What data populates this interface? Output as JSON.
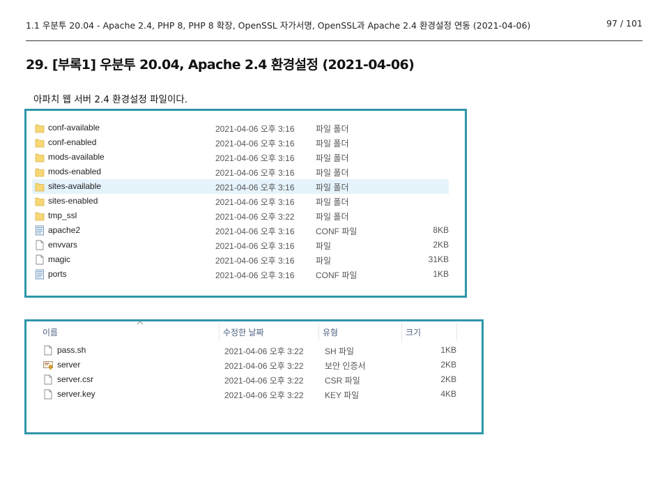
{
  "header": {
    "doc_title": "1.1 우분투 20.04 - Apache 2.4, PHP 8, PHP 8 확장, OpenSSL 자가서명, OpenSSL과 Apache 2.4 환경설정 연동 (2021-04-06)",
    "page": "97 / 101"
  },
  "section_title": "29. [부록1] 우분투 20.04, Apache 2.4 환경설정 (2021-04-06)",
  "description": "아파치 웹 서버 2.4 환경설정 파일이다.",
  "explorer1": {
    "rows": [
      {
        "icon": "folder-icon",
        "name": "conf-available",
        "date": "2021-04-06 오후 3:16",
        "type": "파일 폴더",
        "size": ""
      },
      {
        "icon": "folder-icon",
        "name": "conf-enabled",
        "date": "2021-04-06 오후 3:16",
        "type": "파일 폴더",
        "size": ""
      },
      {
        "icon": "folder-icon",
        "name": "mods-available",
        "date": "2021-04-06 오후 3:16",
        "type": "파일 폴더",
        "size": ""
      },
      {
        "icon": "folder-icon",
        "name": "mods-enabled",
        "date": "2021-04-06 오후 3:16",
        "type": "파일 폴더",
        "size": ""
      },
      {
        "icon": "folder-icon",
        "name": "sites-available",
        "date": "2021-04-06 오후 3:16",
        "type": "파일 폴더",
        "size": ""
      },
      {
        "icon": "folder-icon",
        "name": "sites-enabled",
        "date": "2021-04-06 오후 3:16",
        "type": "파일 폴더",
        "size": ""
      },
      {
        "icon": "folder-icon",
        "name": "tmp_ssl",
        "date": "2021-04-06 오후 3:22",
        "type": "파일 폴더",
        "size": ""
      },
      {
        "icon": "config-file-icon",
        "name": "apache2",
        "date": "2021-04-06 오후 3:16",
        "type": "CONF 파일",
        "size": "8KB"
      },
      {
        "icon": "file-icon",
        "name": "envvars",
        "date": "2021-04-06 오후 3:16",
        "type": "파일",
        "size": "2KB"
      },
      {
        "icon": "file-icon",
        "name": "magic",
        "date": "2021-04-06 오후 3:16",
        "type": "파일",
        "size": "31KB"
      },
      {
        "icon": "config-file-icon",
        "name": "ports",
        "date": "2021-04-06 오후 3:16",
        "type": "CONF 파일",
        "size": "1KB"
      }
    ]
  },
  "explorer2": {
    "columns": [
      "이름",
      "수정한 날짜",
      "유형",
      "크기"
    ],
    "rows": [
      {
        "icon": "file-icon",
        "name": "pass.sh",
        "date": "2021-04-06 오후 3:22",
        "type": "SH 파일",
        "size": "1KB"
      },
      {
        "icon": "certificate-icon",
        "name": "server",
        "date": "2021-04-06 오후 3:22",
        "type": "보안 인증서",
        "size": "2KB"
      },
      {
        "icon": "file-icon",
        "name": "server.csr",
        "date": "2021-04-06 오후 3:22",
        "type": "CSR 파일",
        "size": "2KB"
      },
      {
        "icon": "file-icon",
        "name": "server.key",
        "date": "2021-04-06 오후 3:22",
        "type": "KEY 파일",
        "size": "4KB"
      }
    ]
  },
  "colors": {
    "panel_border": "#2e96a9",
    "selection": "#e5f3fb",
    "folder": "#f8d775"
  }
}
